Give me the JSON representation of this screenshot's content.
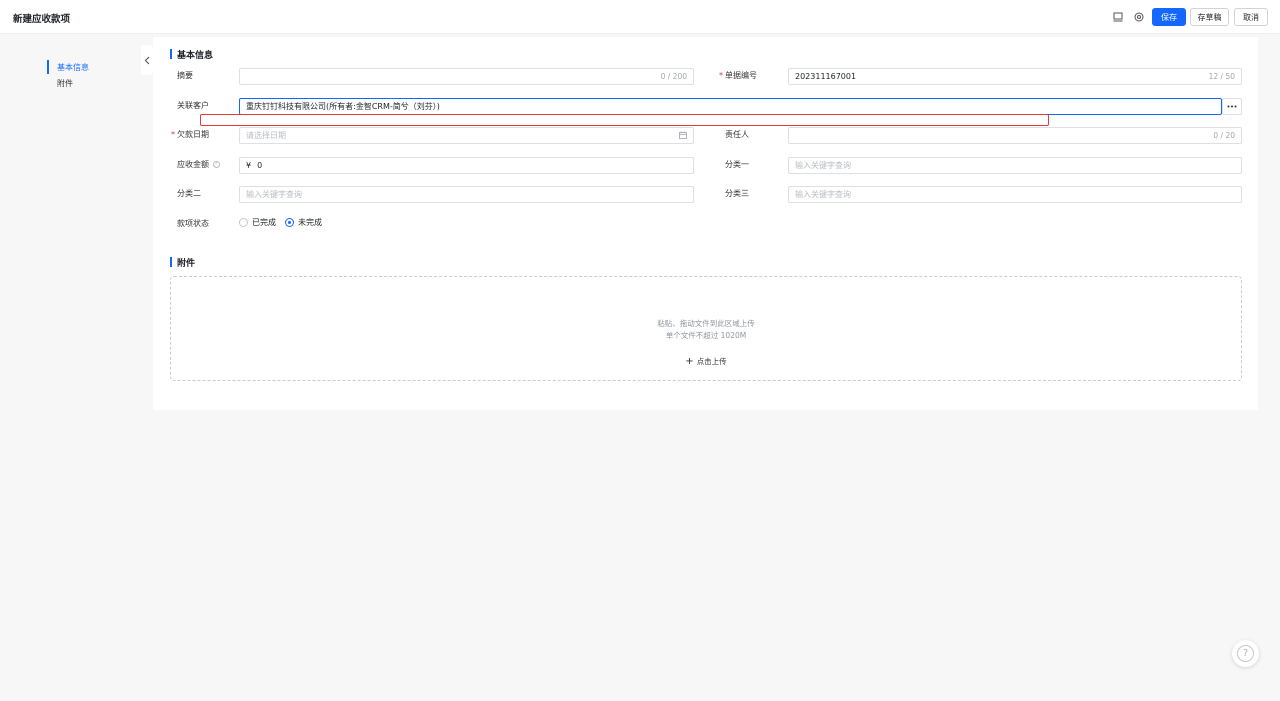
{
  "header": {
    "title": "新建应收款项",
    "save_label": "保存",
    "draft_label": "存草稿",
    "cancel_label": "取消"
  },
  "side_nav": {
    "items": [
      {
        "label": "基本信息",
        "active": true
      },
      {
        "label": "附件",
        "active": false
      }
    ]
  },
  "sections": {
    "basic_title": "基本信息",
    "attachment_title": "附件"
  },
  "form": {
    "summary": {
      "label": "摘要",
      "value": "",
      "count": "0 / 200"
    },
    "doc_no": {
      "label": "单据编号",
      "value": "202311167001",
      "count": "12 / 50"
    },
    "customer": {
      "label": "关联客户",
      "value": "重庆钉钉科技有限公司(所有者:金智CRM-简兮（刘芬）)"
    },
    "due_date": {
      "label": "欠款日期",
      "placeholder": "请选择日期"
    },
    "owner": {
      "label": "责任人",
      "value": "",
      "count": "0 / 20"
    },
    "amount": {
      "label": "应收金额",
      "currency": "¥",
      "value": "0"
    },
    "category1": {
      "label": "分类一",
      "placeholder": "输入关键字查询"
    },
    "category2": {
      "label": "分类二",
      "placeholder": "输入关键字查询"
    },
    "category3": {
      "label": "分类三",
      "placeholder": "输入关键字查询"
    },
    "status": {
      "label": "款项状态",
      "options": [
        "已完成",
        "未完成"
      ],
      "selected": "未完成"
    }
  },
  "upload": {
    "line1": "粘贴、拖动文件到此区域上传",
    "line2": "单个文件不超过 1020M",
    "button": "点击上传"
  },
  "colors": {
    "primary": "#1468ff",
    "required": "#e53935",
    "highlight": "#e53935"
  }
}
